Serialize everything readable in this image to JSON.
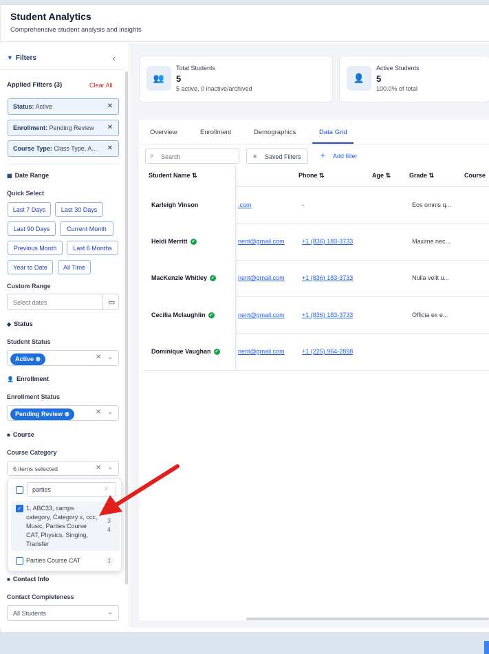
{
  "header": {
    "title": "Student Analytics",
    "subtitle": "Comprehensive student analysis and insights"
  },
  "sidebar": {
    "filters_title": "Filters",
    "applied_filters": "Applied Filters (3)",
    "clear_all": "Clear All",
    "chips": [
      {
        "key": "Status:",
        "value": "Active"
      },
      {
        "key": "Enrollment:",
        "value": "Pending Review"
      },
      {
        "key": "Course Type:",
        "value": "Class Type, A..."
      }
    ],
    "date_range": {
      "title": "Date Range",
      "quick_select": "Quick Select",
      "buttons": [
        "Last 7 Days",
        "Last 30 Days",
        "Last 90 Days",
        "Current Month",
        "Previous Month",
        "Last 6 Months",
        "Year to Date",
        "All Time"
      ],
      "custom_range": "Custom Range",
      "placeholder": "Select dates"
    },
    "status": {
      "title": "Status",
      "label": "Student Status",
      "selected": "Active"
    },
    "enrollment": {
      "title": "Enrollment",
      "label": "Enrollment Status",
      "selected": "Pending Review"
    },
    "course": {
      "title": "Course",
      "label": "Course Category",
      "selected": "6 items selected"
    },
    "dropdown": {
      "search_value": "parties",
      "options": [
        {
          "label": "1, ABC33, camps category, Category x, ccc, Music, Parties Course CAT, Physics, Singing, Transfer",
          "count": "3 4",
          "checked": true
        },
        {
          "label": "Parties Course CAT",
          "count": "1",
          "checked": false
        }
      ]
    },
    "contact": {
      "title": "Contact Info",
      "label": "Contact Completeness",
      "selected": "All Students"
    }
  },
  "stats": [
    {
      "title": "Total Students",
      "value": "5",
      "sub": "5 active, 0 inactive/archived"
    },
    {
      "title": "Active Students",
      "value": "5",
      "sub": "100.0% of total"
    }
  ],
  "tabs": [
    "Overview",
    "Enrollment",
    "Demographics",
    "Data Grid"
  ],
  "toolbar": {
    "search_placeholder": "Search",
    "saved_filters": "Saved Filters",
    "add_filter": "Add filter"
  },
  "table": {
    "headers": [
      "Student Name",
      "Phone",
      "Age",
      "Grade",
      "Course"
    ],
    "rows": [
      {
        "name": "Karleigh Vinson",
        "verified": false,
        "email": ".com",
        "phone": "-",
        "grade": "Eos omnis q..."
      },
      {
        "name": "Heidi Merritt",
        "verified": true,
        "email": "nent@gmail.com",
        "phone": "+1 (836) 183-3733",
        "grade": "Maxime nec..."
      },
      {
        "name": "MacKenzie Whitley",
        "verified": true,
        "email": "nent@gmail.com",
        "phone": "+1 (836) 183-3733",
        "grade": "Nulla velit u..."
      },
      {
        "name": "Cecilia Mclaughlin",
        "verified": true,
        "email": "nent@gmail.com",
        "phone": "+1 (836) 183-3733",
        "grade": "Officia ex e..."
      },
      {
        "name": "Dominique Vaughan",
        "verified": true,
        "email": "nent@gmail.com",
        "phone": "+1 (225) 964-2898",
        "grade": ""
      }
    ]
  },
  "colors": {
    "accent": "#1e6fd9",
    "arrow": "#e0201b",
    "verified": "#16a34a"
  }
}
